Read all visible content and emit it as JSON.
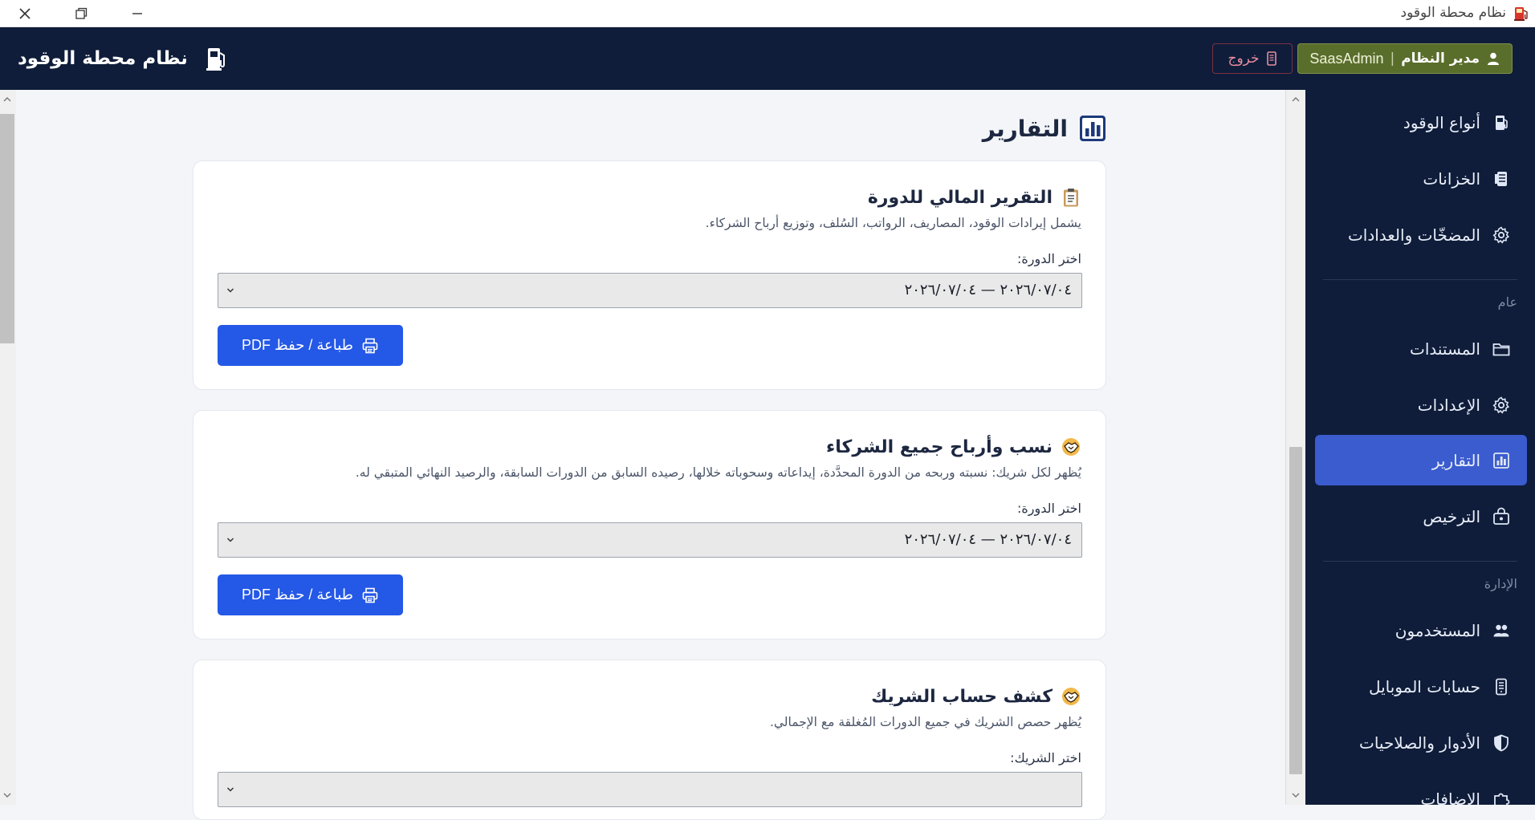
{
  "window": {
    "title": "نظام محطة الوقود",
    "controls": [
      "close-icon",
      "restore-icon",
      "minimize-icon"
    ]
  },
  "header": {
    "app_title": "نظام محطة الوقود",
    "user_role": "مدير النظام",
    "user_separator": "|",
    "username": "SaasAdmin",
    "logout_label": "خروج",
    "colors": {
      "background": "#0f1d3a",
      "user_badge": "#5a6e2c",
      "logout": "#e98da0"
    }
  },
  "sidebar": {
    "items_top": [
      {
        "label": "أنواع الوقود",
        "icon": "fuel-type-icon"
      },
      {
        "label": "الخزانات",
        "icon": "tank-icon"
      },
      {
        "label": "المضخّات والعدادات",
        "icon": "gear-icon"
      }
    ],
    "section_general": "عام",
    "items_general": [
      {
        "label": "المستندات",
        "icon": "folder-icon"
      },
      {
        "label": "الإعدادات",
        "icon": "settings-icon"
      },
      {
        "label": "التقارير",
        "icon": "chart-icon",
        "active": true
      },
      {
        "label": "الترخيص",
        "icon": "license-icon"
      }
    ],
    "section_admin": "الإدارة",
    "items_admin": [
      {
        "label": "المستخدمون",
        "icon": "users-icon"
      },
      {
        "label": "حسابات الموبايل",
        "icon": "mobile-icon"
      },
      {
        "label": "الأدوار والصلاحيات",
        "icon": "shield-icon"
      },
      {
        "label": "الإضافات",
        "icon": "puzzle-icon"
      }
    ],
    "active_color": "#3b5ccf"
  },
  "main": {
    "page_title": "التقارير",
    "cards": [
      {
        "title": "التقرير المالي للدورة",
        "icon": "clipboard-icon",
        "description": "يشمل إيرادات الوقود، المصاريف، الرواتب، السُلف، وتوزيع أرباح الشركاء.",
        "field_label": "اختر الدورة:",
        "selected_value": "٢٠٢٦/٠٧/٠٤ — ٢٠٢٦/٠٧/٠٤",
        "button_label": "طباعة / حفظ PDF"
      },
      {
        "title": "نسب وأرباح جميع الشركاء",
        "icon": "handshake-icon",
        "description": "يُظهر لكل شريك: نسبته وربحه من الدورة المحدَّدة، إيداعاته وسحوباته خلالها، رصيده السابق من الدورات السابقة، والرصيد النهائي المتبقي له.",
        "field_label": "اختر الدورة:",
        "selected_value": "٢٠٢٦/٠٧/٠٤ — ٢٠٢٦/٠٧/٠٤",
        "button_label": "طباعة / حفظ PDF"
      },
      {
        "title": "كشف حساب الشريك",
        "icon": "handshake-icon",
        "description": "يُظهر حصص الشريك في جميع الدورات المُغلقة مع الإجمالي.",
        "field_label": "اختر الشريك:",
        "selected_value": ""
      }
    ],
    "button_color": "#2458e6"
  }
}
